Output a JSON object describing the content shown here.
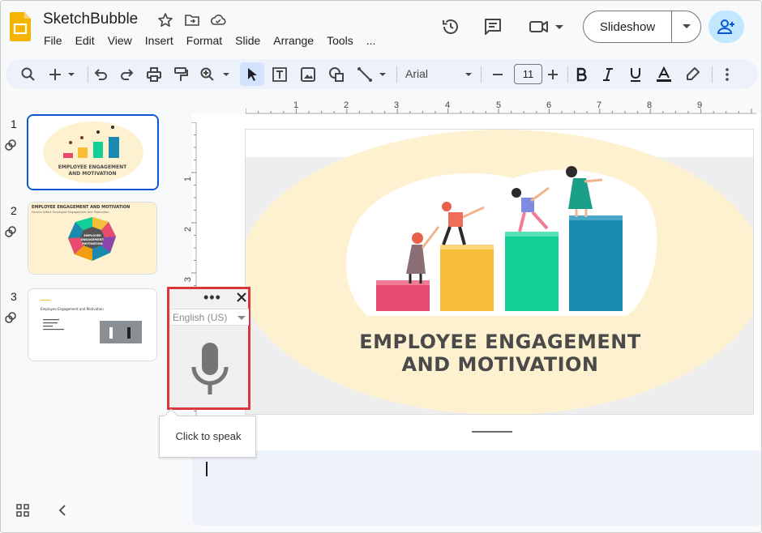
{
  "app": {
    "title": "SketchBubble",
    "menu": [
      "File",
      "Edit",
      "View",
      "Insert",
      "Format",
      "Slide",
      "Arrange",
      "Tools",
      "..."
    ],
    "slideshow_label": "Slideshow"
  },
  "toolbar": {
    "font_name": "Arial",
    "font_size": "11"
  },
  "ruler": {
    "h_ticks": [
      "1",
      "2",
      "3",
      "4",
      "5",
      "6",
      "7",
      "8",
      "9"
    ],
    "v_ticks": [
      "1",
      "2",
      "3"
    ]
  },
  "slides": [
    {
      "number": "1",
      "title": "EMPLOYEE ENGAGEMENT AND MOTIVATION"
    },
    {
      "number": "2",
      "title": "EMPLOYEE ENGAGEMENT AND MOTIVATION",
      "subtitle": "Factors Affect Employee Engagement and Motivation",
      "center_label": "EMPLOYEE ENGAGEMENT AND MOTIVATION"
    },
    {
      "number": "3",
      "title": "Employee Engagement and Motivation"
    }
  ],
  "current_slide": {
    "title_line1": "EMPLOYEE ENGAGEMENT",
    "title_line2": "AND MOTIVATION"
  },
  "voice_typing": {
    "language": "English (US)",
    "tooltip": "Click to speak",
    "more_label": "•••"
  },
  "colors": {
    "accent_blue": "#0b57d0",
    "highlight_red": "#d9363e",
    "bar_pink": "#e84a6f",
    "bar_yellow": "#f7be3a",
    "bar_green": "#13cf95",
    "bar_blue": "#1a8ab1",
    "bg_cream": "#fdf1cf"
  }
}
